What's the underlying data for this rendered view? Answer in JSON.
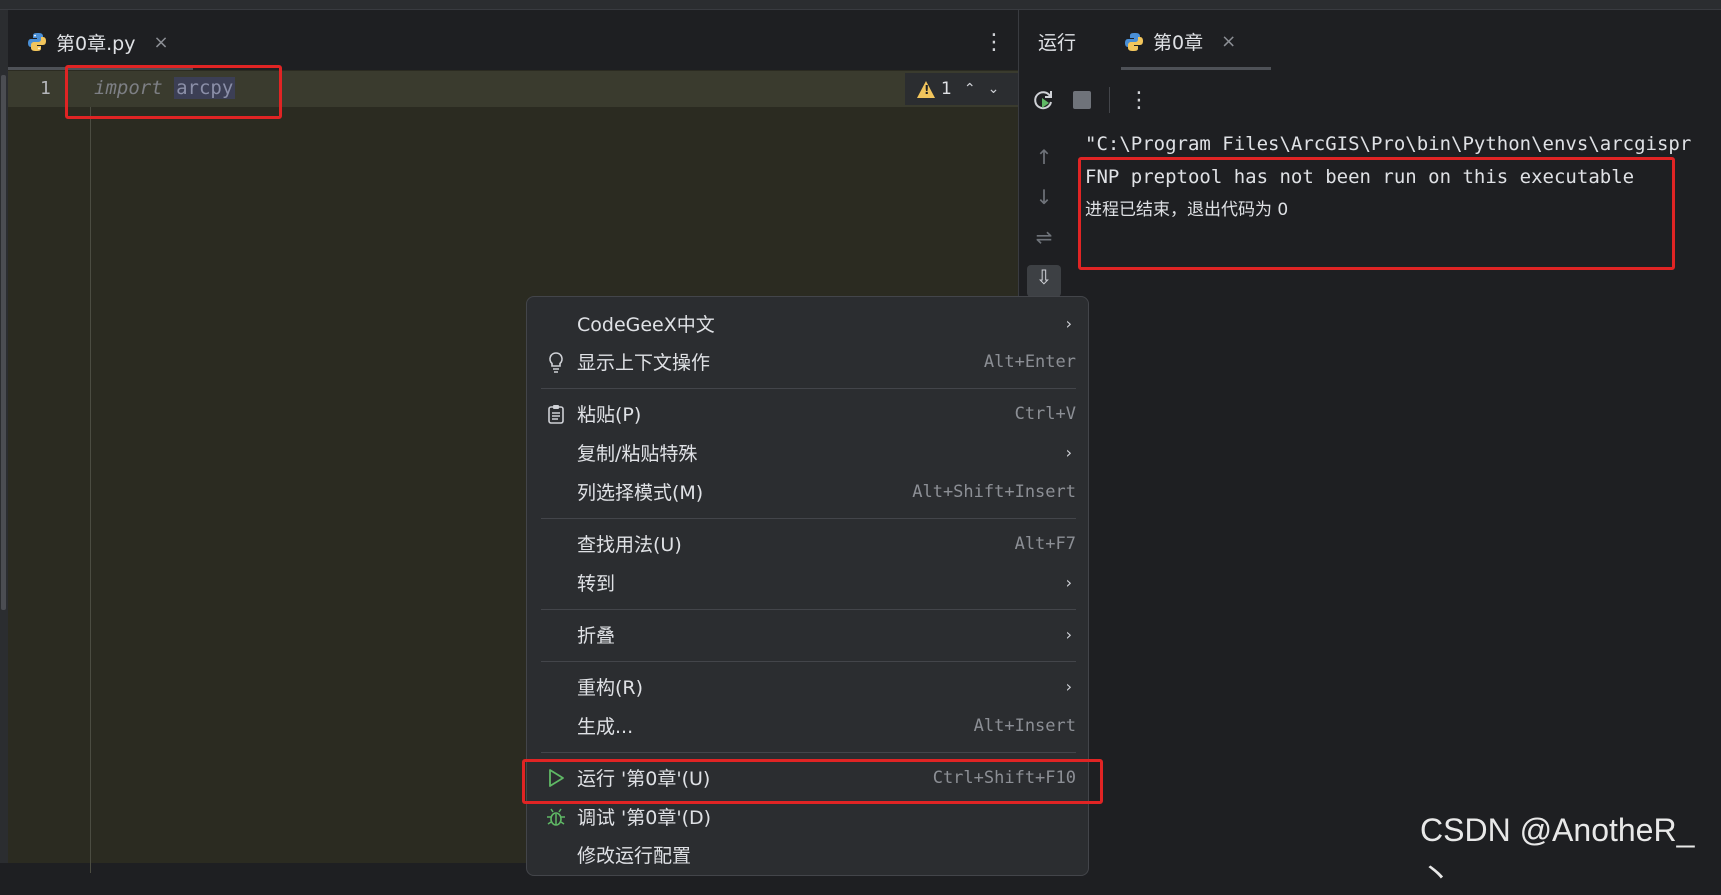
{
  "editor": {
    "tab_label": "第0章.py",
    "tab_close": "×",
    "more": "⋮",
    "line_number": "1",
    "code_keyword": "import",
    "code_module": "arcpy",
    "warning_count": "1",
    "chev_up": "⌃",
    "chev_down": "⌄"
  },
  "run_panel": {
    "title": "运行",
    "tab_label": "第0章",
    "tab_close": "×",
    "more": "⋮",
    "console_lines": [
      "\"C:\\Program Files\\ArcGIS\\Pro\\bin\\Python\\envs\\arcgispr",
      "FNP preptool has not been run on this executable",
      "",
      "进程已结束，退出代码为 0"
    ]
  },
  "context_menu": {
    "items": [
      {
        "label": "CodeGeeX中文",
        "shortcut": "",
        "arrow": "›"
      },
      {
        "label": "显示上下文操作",
        "shortcut": "Alt+Enter",
        "arrow": ""
      },
      {
        "label": "粘贴(P)",
        "shortcut": "Ctrl+V",
        "arrow": ""
      },
      {
        "label": "复制/粘贴特殊",
        "shortcut": "",
        "arrow": "›"
      },
      {
        "label": "列选择模式(M)",
        "shortcut": "Alt+Shift+Insert",
        "arrow": ""
      },
      {
        "label": "查找用法(U)",
        "shortcut": "Alt+F7",
        "arrow": ""
      },
      {
        "label": "转到",
        "shortcut": "",
        "arrow": "›"
      },
      {
        "label": "折叠",
        "shortcut": "",
        "arrow": "›"
      },
      {
        "label": "重构(R)",
        "shortcut": "",
        "arrow": "›"
      },
      {
        "label": "生成...",
        "shortcut": "Alt+Insert",
        "arrow": ""
      },
      {
        "label": "运行 '第0章'(U)",
        "shortcut": "Ctrl+Shift+F10",
        "arrow": ""
      },
      {
        "label": "调试 '第0章'(D)",
        "shortcut": "",
        "arrow": ""
      },
      {
        "label": "修改运行配置",
        "shortcut": "",
        "arrow": ""
      }
    ]
  },
  "watermark": "CSDN @AnotheR_丶",
  "colors": {
    "highlight": "#e02424",
    "run_green": "#5fb865",
    "warning": "#f2c55c"
  }
}
